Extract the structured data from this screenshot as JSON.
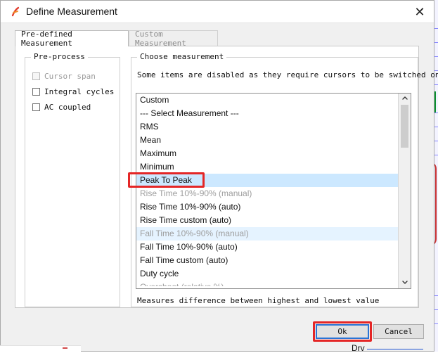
{
  "window": {
    "title": "Define Measurement",
    "close_glyph": "✕"
  },
  "tabs": [
    {
      "label": "Pre-defined Measurement",
      "active": true
    },
    {
      "label": "Custom Measurement",
      "active": false
    }
  ],
  "preprocess": {
    "group_label": "Pre-process",
    "options": [
      {
        "label": "Cursor span",
        "checked": false,
        "disabled": true
      },
      {
        "label": "Integral cycles",
        "checked": false,
        "disabled": false
      },
      {
        "label": "AC coupled",
        "checked": false,
        "disabled": false
      }
    ]
  },
  "choose": {
    "group_label": "Choose measurement",
    "note": "Some items are disabled as they require cursors to be switched on",
    "items": [
      {
        "label": "Custom",
        "state": "normal"
      },
      {
        "label": "--- Select Measurement ---",
        "state": "normal"
      },
      {
        "label": "RMS",
        "state": "normal"
      },
      {
        "label": "Mean",
        "state": "normal"
      },
      {
        "label": "Maximum",
        "state": "normal"
      },
      {
        "label": "Minimum",
        "state": "normal"
      },
      {
        "label": "Peak To Peak",
        "state": "selected"
      },
      {
        "label": "Rise Time 10%-90% (manual)",
        "state": "disabled"
      },
      {
        "label": "Rise Time 10%-90% (auto)",
        "state": "normal"
      },
      {
        "label": "Rise Time custom (auto)",
        "state": "normal"
      },
      {
        "label": "Fall Time 10%-90% (manual)",
        "state": "disabled-hover"
      },
      {
        "label": "Fall Time 10%-90% (auto)",
        "state": "normal"
      },
      {
        "label": "Fall Time custom (auto)",
        "state": "normal"
      },
      {
        "label": "Duty cycle",
        "state": "normal"
      },
      {
        "label": "Overshoot (relative %)",
        "state": "partial-disabled"
      }
    ],
    "description": "Measures difference between highest and lowest value"
  },
  "buttons": {
    "ok": "Ok",
    "cancel": "Cancel"
  },
  "background_snippets": {
    "bottom_right_label": "Drv"
  },
  "icons": {
    "app_icon": "simetrix-app-icon",
    "close": "close-icon",
    "scroll_up": "chevron-up-icon",
    "scroll_down": "chevron-down-icon"
  },
  "colors": {
    "highlight_red": "#e42626",
    "selection_blue": "#cce8ff",
    "disabled_text": "#9d9d9d"
  }
}
